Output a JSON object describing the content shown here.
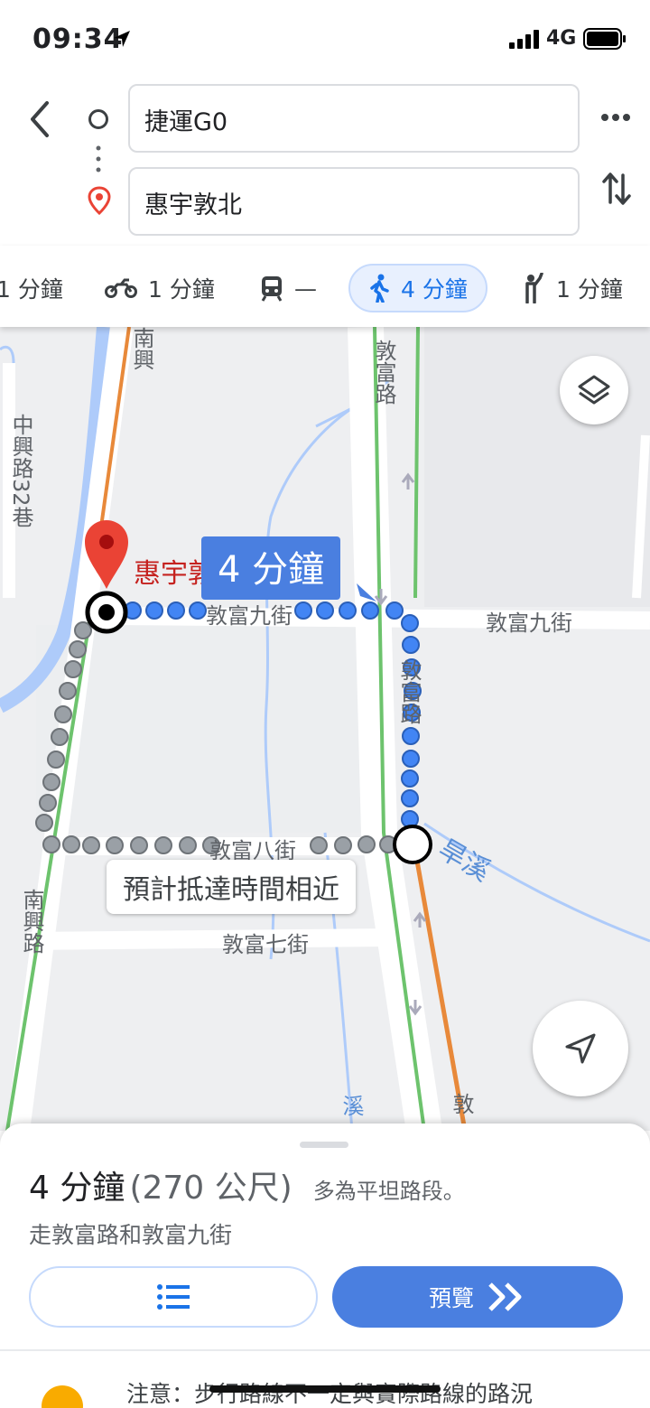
{
  "status_bar": {
    "time": "09:34",
    "network": "4G"
  },
  "route": {
    "origin": "捷運G0",
    "destination": "惠宇敦北"
  },
  "modes": [
    {
      "name": "drive",
      "label": "1 分鐘"
    },
    {
      "name": "motorcycle",
      "label": "1 分鐘"
    },
    {
      "name": "transit",
      "label": "—"
    },
    {
      "name": "walk",
      "label": "4 分鐘",
      "selected": true
    },
    {
      "name": "ride",
      "label": "1 分鐘"
    }
  ],
  "map": {
    "duration_label": "4 分鐘",
    "destination_label": "惠宇敦",
    "eta_callout": "預計抵達時間相近",
    "streets": {
      "dunfu_rd_top": "敦富路",
      "dunfu_rd_mid": "敦富路",
      "dunfu_9th_left": "敦富九街",
      "dunfu_9th_right": "敦富九街",
      "dunfu_8th": "敦富八街",
      "dunfu_7th": "敦富七街",
      "nanxing_top": "南興",
      "nanxing_bottom": "南興路",
      "zhongxing_32": "中興路32巷",
      "dunfu_bottom": "敦",
      "stream_bottom": "溪"
    },
    "river_label": "旱溪"
  },
  "summary": {
    "duration": "4 分鐘",
    "distance": "(270 公尺)",
    "note": "多為平坦路段。",
    "via": "走敦富路和敦富九街",
    "preview_label": "預覽",
    "warning": "注意：步行路線不一定與實際路線的路況"
  },
  "colors": {
    "accent": "#4a7fe0",
    "pin": "#ea4335",
    "route_alt": "#9aa0a6"
  }
}
